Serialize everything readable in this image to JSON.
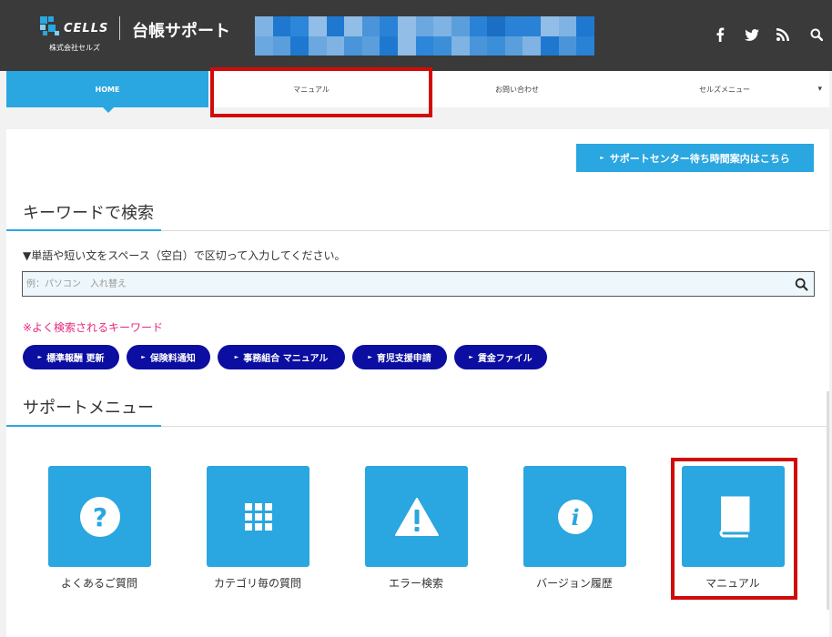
{
  "header": {
    "logo_text": "CELLS",
    "company": "株式会社セルズ",
    "site_title": "台帳サポート",
    "brand_color": "#2aa6e0",
    "social_icons": [
      "facebook-icon",
      "twitter-icon",
      "rss-icon",
      "search-icon"
    ]
  },
  "nav": {
    "items": [
      {
        "label": "HOME",
        "active": true
      },
      {
        "label": "マニュアル"
      },
      {
        "label": "お問い合わせ"
      },
      {
        "label": "セルズメニュー",
        "dropdown_glyph": "▾"
      }
    ]
  },
  "support_center_button": "サポートセンター待ち時間案内はこちら",
  "keyword_section": {
    "title": "キーワードで検索",
    "instruction": "▼単語や短い文をスペース（空白）で区切って入力してください。",
    "search_placeholder": "例：パソコン　入れ替え",
    "popular_label": "※よく検索されるキーワード",
    "popular_tags": [
      "標準報酬 更新",
      "保険料通知",
      "事務組合 マニュアル",
      "育児支援申請",
      "賃金ファイル"
    ]
  },
  "support_menu": {
    "title": "サポートメニュー",
    "tiles": [
      {
        "label": "よくあるご質問",
        "icon": "question-icon"
      },
      {
        "label": "カテゴリ毎の質問",
        "icon": "grid-icon"
      },
      {
        "label": "エラー検索",
        "icon": "warning-icon"
      },
      {
        "label": "バージョン履歴",
        "icon": "info-icon"
      },
      {
        "label": "マニュアル",
        "icon": "book-icon"
      }
    ]
  },
  "colors": {
    "header_bg": "#3a3a3a",
    "accent": "#2aa6e0",
    "tag_bg": "#0b0ea0",
    "highlight_red": "#d10a0a",
    "popular_label": "#e6287a"
  }
}
